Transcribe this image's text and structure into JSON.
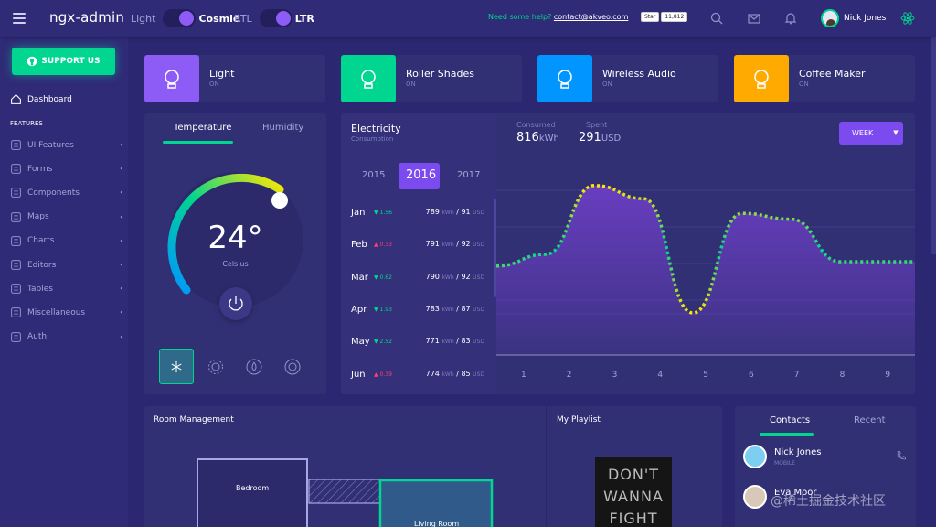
{
  "header": {
    "logo": "ngx-admin",
    "theme_left": "Light",
    "theme_right": "Cosmic",
    "dir_left": "RTL",
    "dir_right": "LTR",
    "help_text": "Need some help?",
    "help_link": "contact@akveo.com",
    "github_star": "Star",
    "github_count": "11,812",
    "user_name": "Nick Jones",
    "icons": [
      "search-icon",
      "mail-icon",
      "bell-icon",
      "react-icon"
    ]
  },
  "sidebar": {
    "support_label": "SUPPORT US",
    "dashboard": "Dashboard",
    "section_label": "FEATURES",
    "items": [
      {
        "label": "UI Features",
        "icon": "grid-icon"
      },
      {
        "label": "Forms",
        "icon": "edit-icon"
      },
      {
        "label": "Components",
        "icon": "gear-icon"
      },
      {
        "label": "Maps",
        "icon": "map-icon"
      },
      {
        "label": "Charts",
        "icon": "chart-icon"
      },
      {
        "label": "Editors",
        "icon": "text-icon"
      },
      {
        "label": "Tables",
        "icon": "table-icon"
      },
      {
        "label": "Miscellaneous",
        "icon": "shuffle-icon"
      },
      {
        "label": "Auth",
        "icon": "lock-icon"
      }
    ]
  },
  "devices": [
    {
      "title": "Light",
      "status": "ON",
      "color": "#8d5cf7",
      "icon": "bulb-icon"
    },
    {
      "title": "Roller Shades",
      "status": "ON",
      "color": "#00d68f",
      "icon": "shades-icon"
    },
    {
      "title": "Wireless Audio",
      "status": "ON",
      "color": "#0095ff",
      "icon": "speaker-icon"
    },
    {
      "title": "Coffee Maker",
      "status": "ON",
      "color": "#ffaa00",
      "icon": "coffee-icon"
    }
  ],
  "temperature": {
    "tab_active": "Temperature",
    "tab_other": "Humidity",
    "value": "24°",
    "unit": "Celsius",
    "modes": [
      "snowflake-icon",
      "sun-icon",
      "drop-icon",
      "wind-icon"
    ]
  },
  "electricity": {
    "title": "Electricity",
    "subtitle": "Consumption",
    "years": [
      "2015",
      "2016",
      "2017"
    ],
    "active_year": "2016",
    "kwh_unit": "kWh",
    "usd_unit": "USD",
    "months": [
      {
        "month": "Jan",
        "delta": "1.56",
        "trend": "down",
        "kwh": "789",
        "usd": "91"
      },
      {
        "month": "Feb",
        "delta": "0.33",
        "trend": "up",
        "kwh": "791",
        "usd": "92"
      },
      {
        "month": "Mar",
        "delta": "0.62",
        "trend": "down",
        "kwh": "790",
        "usd": "92"
      },
      {
        "month": "Apr",
        "delta": "1.93",
        "trend": "down",
        "kwh": "783",
        "usd": "87"
      },
      {
        "month": "May",
        "delta": "2.52",
        "trend": "down",
        "kwh": "771",
        "usd": "83"
      },
      {
        "month": "Jun",
        "delta": "0.39",
        "trend": "up",
        "kwh": "774",
        "usd": "85"
      }
    ]
  },
  "chart_header": {
    "consumed_label": "Consumed",
    "consumed_value": "816",
    "consumed_unit": "kWh",
    "spent_label": "Spent",
    "spent_value": "291",
    "spent_unit": "USD",
    "period": "WEEK"
  },
  "chart_data": {
    "type": "area",
    "categories": [
      "1",
      "2",
      "3",
      "4",
      "5",
      "6",
      "7",
      "8",
      "9"
    ],
    "values": [
      0.42,
      0.5,
      0.97,
      0.88,
      0.1,
      0.78,
      0.74,
      0.45,
      0.45
    ],
    "ylim": [
      0,
      1
    ],
    "grid": true,
    "line_color": "#00d68f",
    "fill_color": "#6f3fc9"
  },
  "room": {
    "title": "Room Management",
    "rooms": [
      "Bedroom",
      "Living Room"
    ]
  },
  "playlist": {
    "title": "My Playlist",
    "album_text": [
      "DON'T",
      "WANNA",
      "FIGHT"
    ]
  },
  "contacts": {
    "tab_active": "Contacts",
    "tab_other": "Recent",
    "list": [
      {
        "name": "Nick Jones",
        "type": "MOBILE"
      },
      {
        "name": "Eva Moor",
        "type": ""
      }
    ]
  },
  "watermark": "@稀土掘金技术社区",
  "colors": {
    "bg": "#2b2770",
    "card": "#323075",
    "accent": "#8d5cf7",
    "success": "#00d68f",
    "danger": "#ff3d71"
  }
}
